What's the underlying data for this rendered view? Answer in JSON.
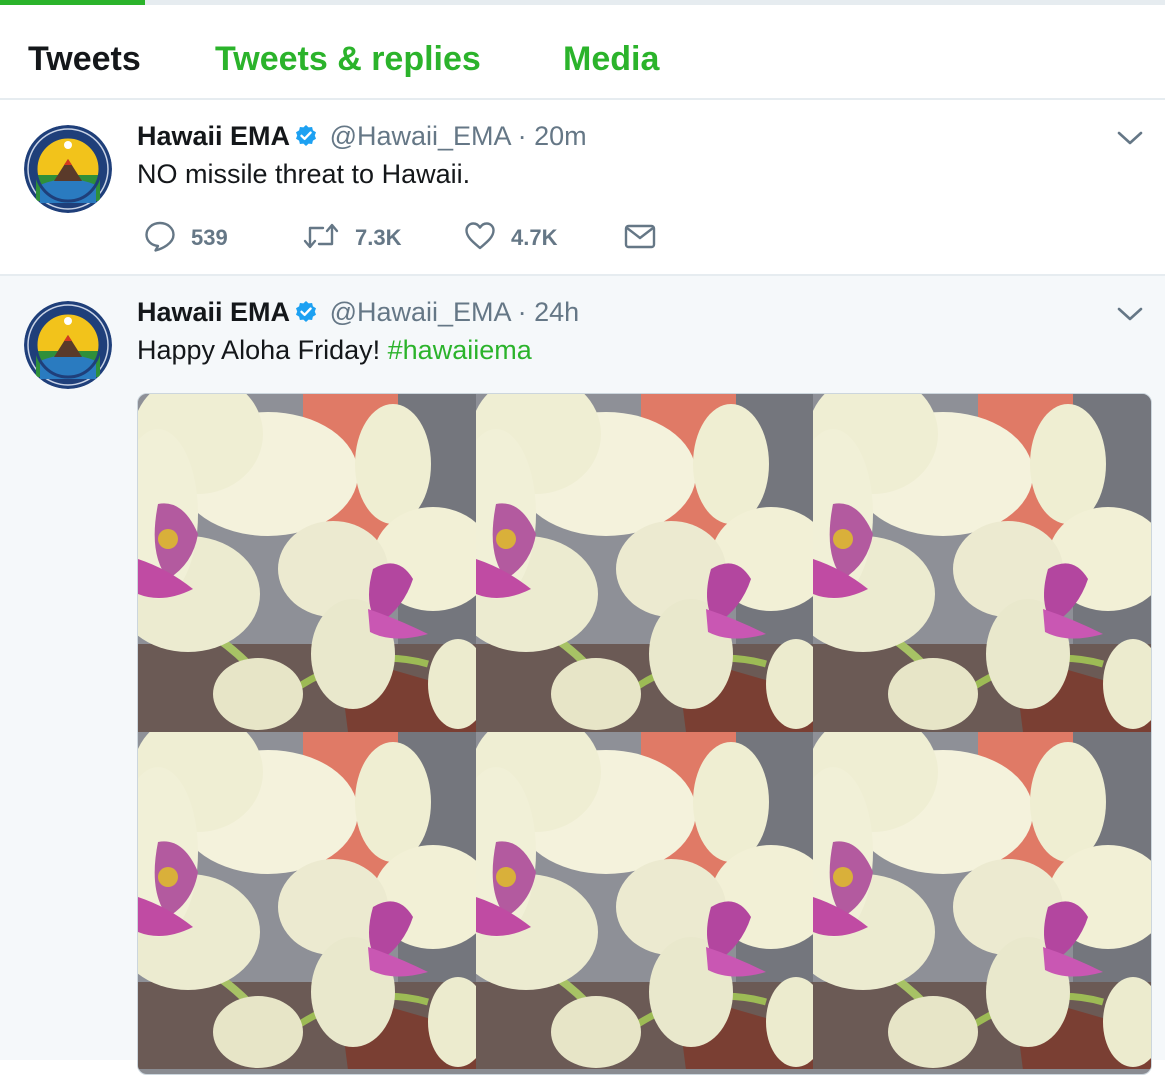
{
  "colors": {
    "accent": "#2bb32b",
    "verified": "#1da1f2",
    "muted": "#657786",
    "text": "#14171a"
  },
  "tabs": [
    {
      "label": "Tweets",
      "active": true
    },
    {
      "label": "Tweets & replies",
      "active": false
    },
    {
      "label": "Media",
      "active": false
    }
  ],
  "tweets": [
    {
      "author": "Hawaii EMA",
      "verified": true,
      "handle": "@Hawaii_EMA",
      "separator": "·",
      "time": "20m",
      "text": "NO missile threat to Hawaii.",
      "replies": "539",
      "retweets": "7.3K",
      "likes": "4.7K"
    },
    {
      "author": "Hawaii EMA",
      "verified": true,
      "handle": "@Hawaii_EMA",
      "separator": "·",
      "time": "24h",
      "text": "Happy Aloha Friday! ",
      "hashtag": "#hawaiiema",
      "media": "orchid-photo-grid"
    }
  ],
  "icons": {
    "reply": "reply-icon",
    "retweet": "retweet-icon",
    "like": "heart-icon",
    "message": "envelope-icon",
    "menu": "chevron-down-icon",
    "verified": "verified-badge-icon"
  }
}
